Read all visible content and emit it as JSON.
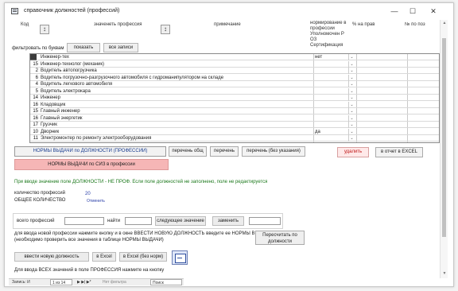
{
  "window": {
    "title": "справочник должностей (профессий)"
  },
  "header": {
    "col_code": "Код",
    "col_name": "значенеть профессия",
    "col_note": "примечание",
    "col_flag": "нормирование в профессии Уполномочен Р ОЗ Сертификация",
    "col_price": "% на прав",
    "col_region": "№ по поз",
    "sort_glyph": "↕"
  },
  "filter": {
    "label": "фильтровать по буквам",
    "show_btn": "показать",
    "reset_btn": "все записи"
  },
  "grid": {
    "rows": [
      {
        "code": "",
        "name": "Инженер-тех",
        "flag": "нет"
      },
      {
        "code": "15",
        "name": "Инженер-технолог (механик)",
        "flag": ""
      },
      {
        "code": "2",
        "name": "Водитель автопогрузчика",
        "flag": ""
      },
      {
        "code": "6",
        "name": "Водитель погрузочно-разгрузочного автомобиля с гидроманипулятором на складе",
        "flag": ""
      },
      {
        "code": "4",
        "name": "Водитель легкового автомобиля",
        "flag": ""
      },
      {
        "code": "5",
        "name": "Водитель электрокара",
        "flag": ""
      },
      {
        "code": "14",
        "name": "Инженер",
        "flag": ""
      },
      {
        "code": "16",
        "name": "Кладовщик",
        "flag": ""
      },
      {
        "code": "15",
        "name": "Главный инженер",
        "flag": ""
      },
      {
        "code": "16",
        "name": "Главный энергетик",
        "flag": ""
      },
      {
        "code": "17",
        "name": "Грузчик",
        "flag": ""
      },
      {
        "code": "10",
        "name": "Дворник",
        "flag": "да"
      },
      {
        "code": "11",
        "name": "Электромонтер по ремонту электрооборудования",
        "flag": ""
      }
    ],
    "drop_glyph": "⌄"
  },
  "tabs": {
    "norms_main": "НОРМЫ ВЫДАЧИ по ДОЛЖНОСТИ (ПРОФЕССИИ)",
    "by_general": "перечень общ",
    "by_list": "перечень",
    "by_list_free": "перечень (без указания)",
    "delete": "удалить",
    "to_excel": "в отчет в EXCEL",
    "norms_siz": "НОРМЫ ВЫДАЧИ по СИЗ в профессии"
  },
  "info": {
    "green_note": "При вводе значение поле ДОЛЖНОСТИ - НЕ ПРОФ. Если поле должностей не заполнено, поле не редактируется",
    "count_label": "количество профессий",
    "count_value": "20",
    "extra_label": "ОБЩЕЕ КОЛИЧЕСТВО",
    "blue_link": "Отменить"
  },
  "search": {
    "label1": "всего профессий",
    "field1": "",
    "label2": "найти",
    "field2": "",
    "btn_search": "следующее значение",
    "label3": "заменить",
    "field3": ""
  },
  "bottom": {
    "line1": "для ввода новой профессии нажмите кнопку и в окне ВВЕСТИ НОВУЮ ДОЛЖНОСТЬ введите ее НОРМЫ ВЫДАЧИ",
    "line2": "(необходимо проверить все значения в таблице НОРМЫ ВЫДАЧИ)",
    "big_btn": "Пересчитать по должности",
    "btn_add": "ввести новую должность",
    "btn_excel1": "в Excel",
    "btn_excel2": "в Excel (без норм)",
    "footer_note": "Для ввода ВСЕХ значений в поле ПРОФЕССИЯ нажмите на кнопку"
  },
  "status": {
    "record_label": "Запись: И",
    "record_pos": "1 из 14",
    "nav_glyphs": "▶ ▶| ▶*",
    "filter_state": "Нет фильтра",
    "search_label": "Поиск"
  },
  "controls": {
    "minimize": "—",
    "maximize": "☐",
    "close": "✕"
  }
}
